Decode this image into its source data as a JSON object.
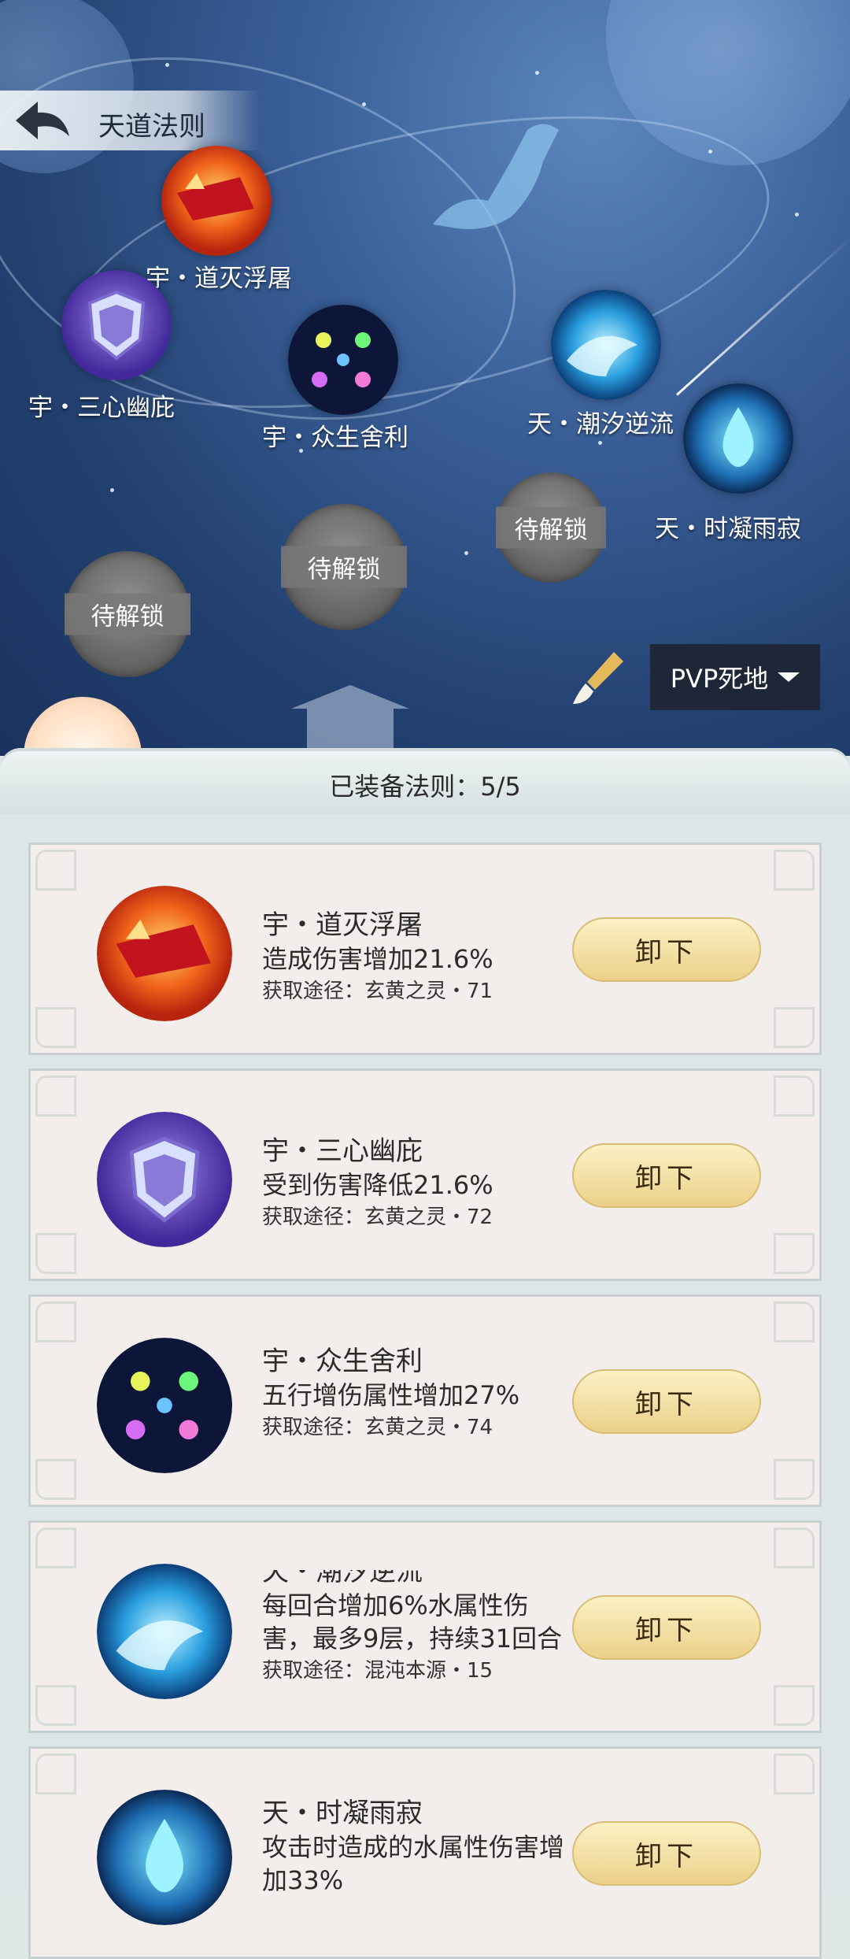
{
  "header": {
    "title": "天道法则"
  },
  "skill_tree": {
    "nodes": [
      {
        "label": "宇・道灭浮屠",
        "icon": "fire-blade-icon"
      },
      {
        "label": "宇・三心幽庇",
        "icon": "purple-shield-icon"
      },
      {
        "label": "宇・众生舍利",
        "icon": "comet-orbs-icon"
      },
      {
        "label": "天・潮汐逆流",
        "icon": "tidal-wave-icon"
      },
      {
        "label": "天・时凝雨寂",
        "icon": "water-drop-icon"
      }
    ],
    "locked": [
      {
        "label": "待解锁"
      },
      {
        "label": "待解锁"
      },
      {
        "label": "待解锁"
      }
    ]
  },
  "mode_select": {
    "value": "PVP死地"
  },
  "panel": {
    "equipped_label": "已装备法则：5/5",
    "unload_label": "卸下",
    "cards": [
      {
        "name": "宇・道灭浮屠",
        "desc": "造成伤害增加21.6%",
        "source": "获取途径：玄黄之灵・71",
        "icon": "fire-blade-icon"
      },
      {
        "name": "宇・三心幽庇",
        "desc": "受到伤害降低21.6%",
        "source": "获取途径：玄黄之灵・72",
        "icon": "purple-shield-icon"
      },
      {
        "name": "宇・众生舍利",
        "desc": "五行增伤属性增加27%",
        "source": "获取途径：玄黄之灵・74",
        "icon": "comet-orbs-icon"
      },
      {
        "name": "天・潮汐逆流",
        "desc": "每回合增加6%水属性伤害，最多9层，持续31回合",
        "source": "获取途径：混沌本源・15",
        "icon": "tidal-wave-icon"
      },
      {
        "name": "天・时凝雨寂",
        "desc": "攻击时造成的水属性伤害增加33%",
        "source": "",
        "icon": "water-drop-icon"
      }
    ]
  },
  "colors": {
    "button_gold": "#ecd089",
    "dropdown_bg": "#1d2738",
    "card_bg": "#f3eeec"
  }
}
